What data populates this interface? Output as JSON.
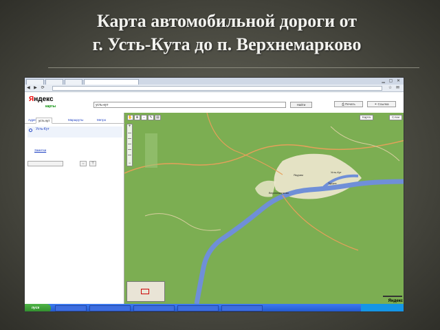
{
  "slide": {
    "title_line1": "Карта автомобильной дороги от",
    "title_line2": "г. Усть-Кута до п. Верхнемарково"
  },
  "header": {
    "logo_first_letter": "Я",
    "logo_rest": "ндекс",
    "logo_sub": "карты",
    "search_value": "усть-кут",
    "find_label": "Найти",
    "print_label": "Печать",
    "link_label": "Ссылка"
  },
  "sidebar": {
    "tabs": [
      "Адрес",
      "Маршруты",
      "Метро"
    ],
    "active_tab": "усть кут",
    "result_name": "Усть-Кут",
    "save_link": "Заметки"
  },
  "map": {
    "labels": [
      "Якурим",
      "Усть-Кут",
      "Турука",
      "Верхнемарково"
    ],
    "map_type_btn": "Карта",
    "layers_btn": "Слои",
    "logo": "Яндекс"
  },
  "taskbar": {
    "start_label": "пуск"
  },
  "colors": {
    "map_green": "#7cae52",
    "river": "#6f8fd8",
    "road": "#e6a05a",
    "city": "#efe8d0"
  }
}
